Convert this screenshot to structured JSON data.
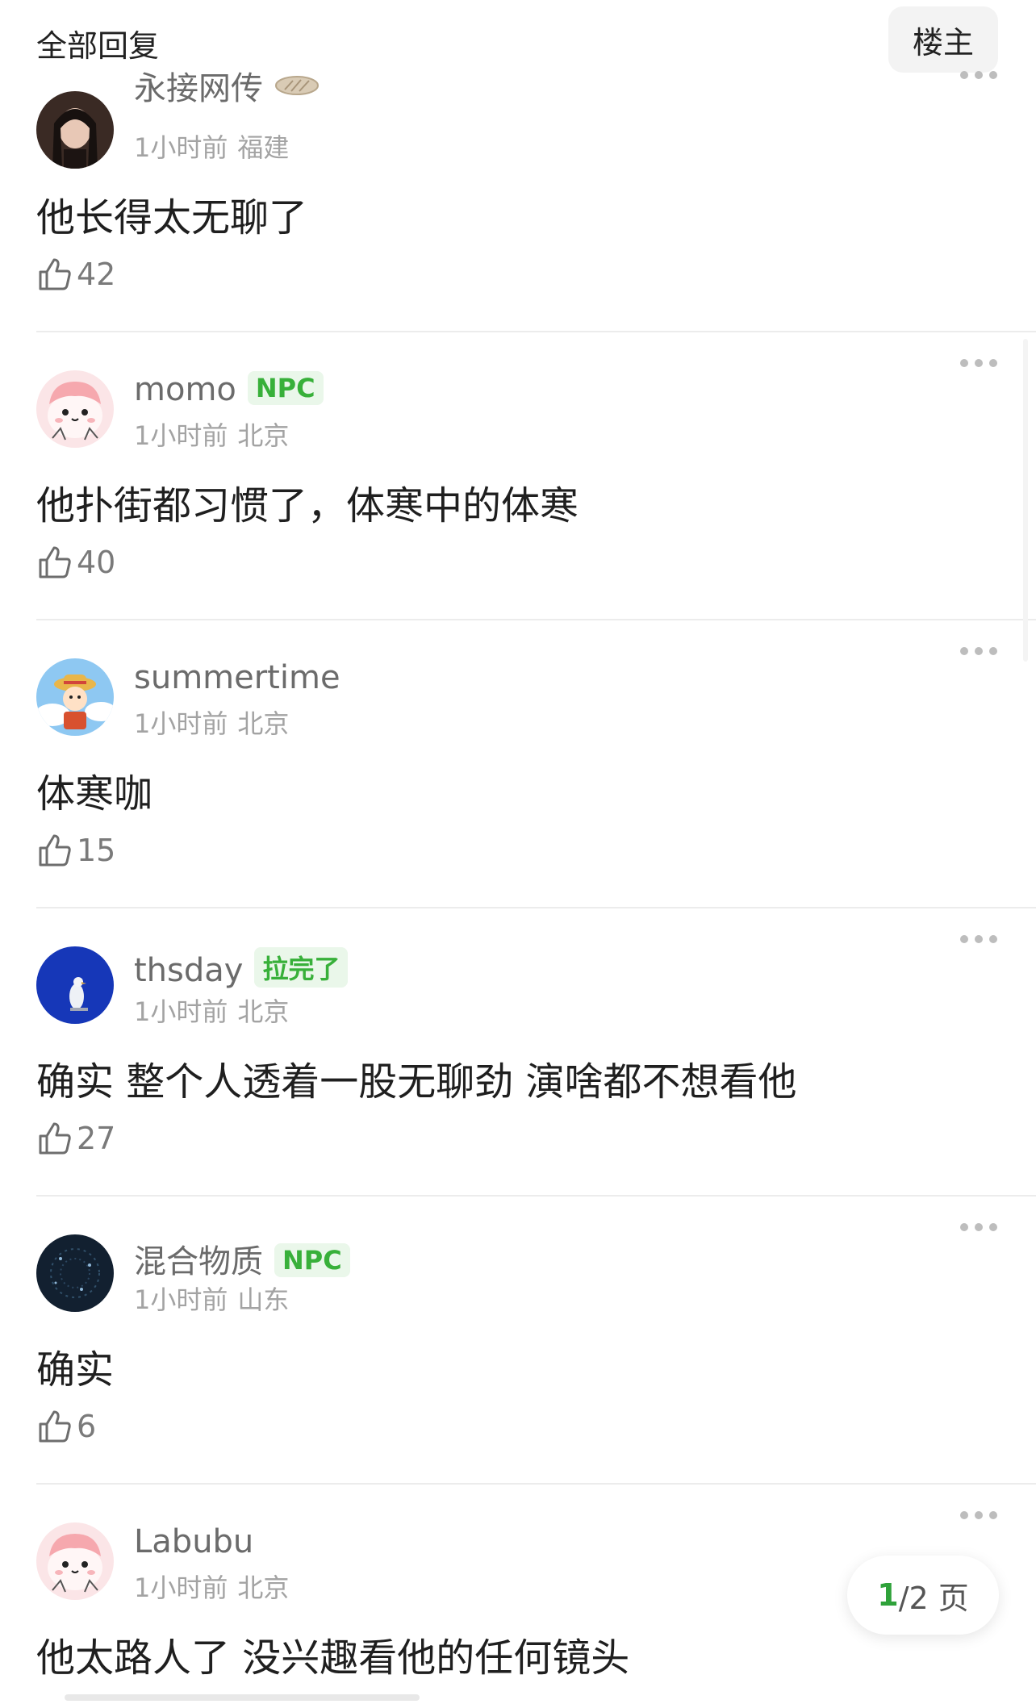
{
  "header": {
    "title": "全部回复",
    "op_button": "楼主"
  },
  "comments": [
    {
      "user": "永接网传",
      "badge": "",
      "time": "1小时前",
      "location": "福建",
      "text": "他长得太无聊了",
      "likes": "42",
      "avatar": "portrait"
    },
    {
      "user": "momo",
      "badge": "NPC",
      "time": "1小时前",
      "location": "北京",
      "text": "他扑街都习惯了，体寒中的体寒",
      "likes": "40",
      "avatar": "pink-cartoon"
    },
    {
      "user": "summertime",
      "badge": "",
      "time": "1小时前",
      "location": "北京",
      "text": "体寒咖",
      "likes": "15",
      "avatar": "straw-hat-cartoon"
    },
    {
      "user": "thsday",
      "badge": "拉完了",
      "time": "1小时前",
      "location": "北京",
      "text": "确实  整个人透着一股无聊劲 演啥都不想看他",
      "likes": "27",
      "avatar": "blue-bird"
    },
    {
      "user": "混合物质",
      "badge": "NPC",
      "time": "1小时前",
      "location": "山东",
      "text": "确实",
      "likes": "6",
      "avatar": "dark-sparkle"
    },
    {
      "user": "Labubu",
      "badge": "",
      "time": "1小时前",
      "location": "北京",
      "text": "他太路人了 没兴趣看他的任何镜头",
      "likes": "",
      "avatar": "pink-cartoon"
    }
  ],
  "pagination": {
    "current": "1",
    "rest": "/2 页"
  },
  "icons": {
    "like": "thumbs-up-icon",
    "more": "more-dots-icon"
  },
  "colors": {
    "badge_green": "#38b03a",
    "page_green": "#2fa23a"
  }
}
